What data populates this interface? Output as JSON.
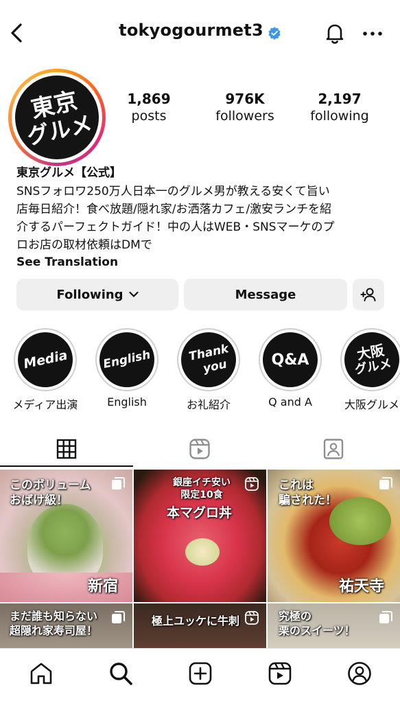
{
  "header": {
    "username": "tokyogourmet3",
    "icons": [
      "back-arrow-icon",
      "verified-badge-icon",
      "bell-icon",
      "more-icon"
    ]
  },
  "profile": {
    "avatar_text_line1": "東京",
    "avatar_text_line2": "グルメ",
    "stats": [
      {
        "value": "1,869",
        "label": "posts"
      },
      {
        "value": "976K",
        "label": "followers"
      },
      {
        "value": "2,197",
        "label": "following"
      }
    ],
    "bio_name": "東京グルメ【公式】",
    "bio_lines": [
      "SNSフォロワ250万人日本一のグルメ男が教える安くて旨い",
      "店毎日紹介！食べ放題/隠れ家/お洒落カフェ/激安ランチを紹",
      "介するパーフェクトガイド！中の人はWEB・SNSマーケのプ",
      "ロお店の取材依頼はDMで"
    ],
    "see_translation": "See Translation"
  },
  "actions": {
    "following_label": "Following",
    "message_label": "Message"
  },
  "highlights": [
    {
      "cover_line1": "Media",
      "cover_line2": "",
      "label": "メディア出演"
    },
    {
      "cover_line1": "English",
      "cover_line2": "",
      "label": "English"
    },
    {
      "cover_line1": "Thank",
      "cover_line2": "you",
      "label": "お礼紹介"
    },
    {
      "cover_line1": "Q&A",
      "cover_line2": "",
      "label": "Q and A"
    },
    {
      "cover_line1": "大阪",
      "cover_line2": "グルメ",
      "label": "大阪グルメ"
    }
  ],
  "tabs": [
    "grid-icon",
    "reels-icon",
    "tagged-icon"
  ],
  "posts": [
    {
      "caption_top1": "このボリューム",
      "caption_top2": "おばけ級！",
      "caption_bottom": "新宿"
    },
    {
      "caption_top1": "銀座イチ安い",
      "caption_top2": "限定10食",
      "caption_top3": "本マグロ丼"
    },
    {
      "caption_top1": "これは",
      "caption_top2": "騙された！",
      "caption_bottom": "祐天寺"
    },
    {
      "caption_top1": "まだ誰も知らない",
      "caption_top2": "超隠れ家寿司屋！"
    },
    {
      "caption_top1": "極上ユッケに牛刺"
    },
    {
      "caption_top1": "究極の",
      "caption_top2": "栗のスイーツ！"
    }
  ],
  "bottom_nav": [
    "home-icon",
    "search-icon",
    "create-icon",
    "reels-icon",
    "profile-icon"
  ]
}
